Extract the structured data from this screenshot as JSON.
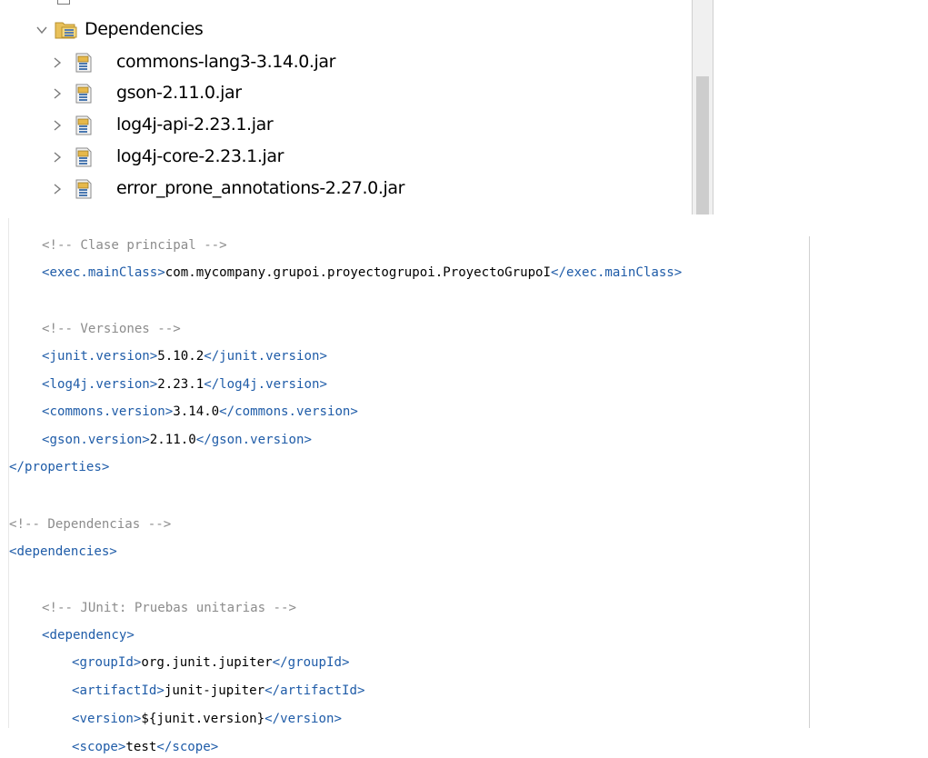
{
  "tree": {
    "root": {
      "label": "Dependencies",
      "expanded": true
    },
    "items": [
      {
        "label": "commons-lang3-3.14.0.jar"
      },
      {
        "label": "gson-2.11.0.jar"
      },
      {
        "label": "log4j-api-2.23.1.jar"
      },
      {
        "label": "log4j-core-2.23.1.jar"
      },
      {
        "label": "error_prone_annotations-2.27.0.jar"
      }
    ]
  },
  "editor": {
    "lines": [
      [
        {
          "t": "comment",
          "v": "<!-- Clase principal -->"
        }
      ],
      [
        {
          "t": "tag",
          "v": "<exec.mainClass>"
        },
        {
          "t": "text",
          "v": "com.mycompany.grupoi.proyectogrupoi.ProyectoGrupoI"
        },
        {
          "t": "tag",
          "v": "</exec.mainClass>"
        }
      ],
      [],
      [
        {
          "t": "comment",
          "v": "<!-- Versiones -->"
        }
      ],
      [
        {
          "t": "tag",
          "v": "<junit.version>"
        },
        {
          "t": "text",
          "v": "5.10.2"
        },
        {
          "t": "tag",
          "v": "</junit.version>"
        }
      ],
      [
        {
          "t": "tag",
          "v": "<log4j.version>"
        },
        {
          "t": "text",
          "v": "2.23.1"
        },
        {
          "t": "tag",
          "v": "</log4j.version>"
        }
      ],
      [
        {
          "t": "tag",
          "v": "<commons.version>"
        },
        {
          "t": "text",
          "v": "3.14.0"
        },
        {
          "t": "tag",
          "v": "</commons.version>"
        }
      ],
      [
        {
          "t": "tag",
          "v": "<gson.version>"
        },
        {
          "t": "text",
          "v": "2.11.0"
        },
        {
          "t": "tag",
          "v": "</gson.version>"
        }
      ],
      [
        {
          "t": "tag",
          "v": "</properties>"
        }
      ],
      [],
      [
        {
          "t": "comment",
          "v": "<!-- Dependencias -->"
        }
      ],
      [
        {
          "t": "tag",
          "v": "<dependencies>"
        }
      ],
      [],
      [
        {
          "t": "comment",
          "v": "<!-- JUnit: Pruebas unitarias -->"
        }
      ],
      [
        {
          "t": "tag",
          "v": "<dependency>"
        }
      ],
      [
        {
          "t": "tag",
          "v": "<groupId>"
        },
        {
          "t": "text",
          "v": "org.junit.jupiter"
        },
        {
          "t": "tag",
          "v": "</groupId>"
        }
      ],
      [
        {
          "t": "tag",
          "v": "<artifactId>"
        },
        {
          "t": "text",
          "v": "junit-jupiter"
        },
        {
          "t": "tag",
          "v": "</artifactId>"
        }
      ],
      [
        {
          "t": "tag",
          "v": "<version>"
        },
        {
          "t": "text",
          "v": "${junit.version}"
        },
        {
          "t": "tag",
          "v": "</version>"
        }
      ],
      [
        {
          "t": "tag",
          "v": "<scope>"
        },
        {
          "t": "text",
          "v": "test"
        },
        {
          "t": "tag",
          "v": "</scope>"
        }
      ]
    ]
  },
  "colors": {
    "comment": "#8c8c8c",
    "tag": "#1f5ca8",
    "text": "#000000"
  }
}
